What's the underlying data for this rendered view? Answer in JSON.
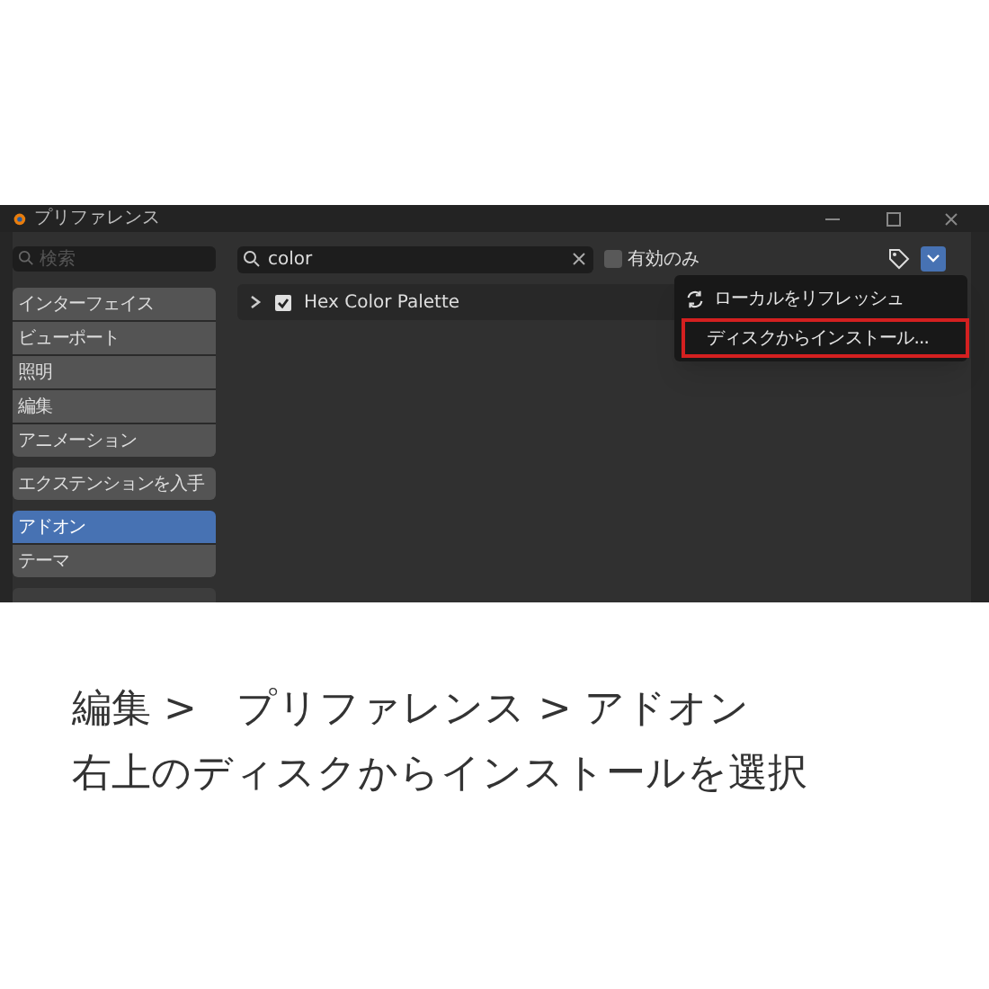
{
  "window": {
    "title": "プリファレンス"
  },
  "sidebar": {
    "search": {
      "placeholder": "検索"
    },
    "groups": [
      [
        {
          "label": "インターフェイス",
          "selected": false
        },
        {
          "label": "ビューポート",
          "selected": false
        },
        {
          "label": "照明",
          "selected": false
        },
        {
          "label": "編集",
          "selected": false
        },
        {
          "label": "アニメーション",
          "selected": false
        }
      ],
      [
        {
          "label": "エクステンションを入手",
          "selected": false
        }
      ],
      [
        {
          "label": "アドオン",
          "selected": true
        },
        {
          "label": "テーマ",
          "selected": false
        }
      ]
    ]
  },
  "search": {
    "value": "color"
  },
  "filter": {
    "label": "有効のみ",
    "checked": false
  },
  "addons": [
    {
      "name": "Hex Color Palette",
      "expanded": false,
      "enabled": true
    }
  ],
  "menu": {
    "items": [
      {
        "label": "ローカルをリフレッシュ",
        "kind": "refresh",
        "highlighted": false
      },
      {
        "label": "ディスクからインストール...",
        "kind": "plain",
        "highlighted": true
      }
    ]
  },
  "caption": [
    "編集 >　プリファレンス > アドオン",
    "右上のディスクからインストールを選択"
  ]
}
